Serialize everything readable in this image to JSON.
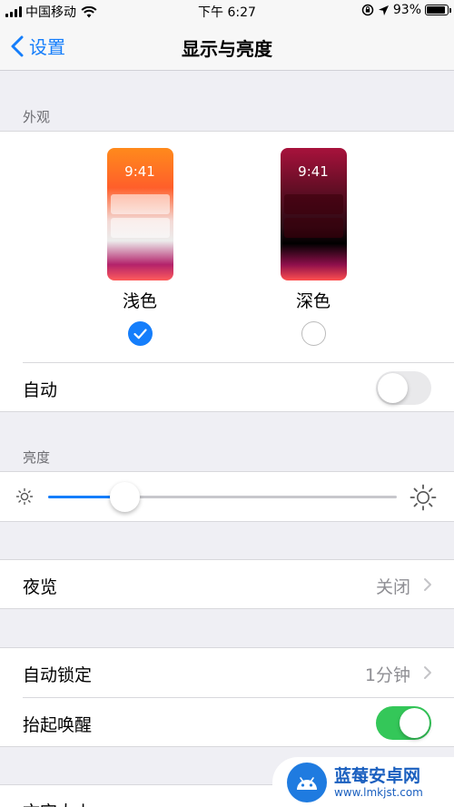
{
  "status_bar": {
    "carrier": "中国移动",
    "time": "下午 6:27",
    "battery": "93%",
    "battery_level": 0.93
  },
  "nav": {
    "back_label": "设置",
    "title": "显示与亮度"
  },
  "appearance": {
    "section_label": "外观",
    "modes": [
      {
        "label": "浅色",
        "preview_time": "9:41",
        "selected": true
      },
      {
        "label": "深色",
        "preview_time": "9:41",
        "selected": false
      }
    ],
    "auto_label": "自动",
    "auto_on": false
  },
  "brightness": {
    "section_label": "亮度",
    "level": 0.22
  },
  "night_shift": {
    "label": "夜览",
    "value": "关闭"
  },
  "auto_lock": {
    "label": "自动锁定",
    "value": "1分钟"
  },
  "raise_to_wake": {
    "label": "抬起唤醒",
    "on": true
  },
  "text_size": {
    "label": "文字大小"
  },
  "watermark": {
    "title": "蓝莓安卓网",
    "url": "www.lmkjst.com"
  },
  "colors": {
    "accent": "#157efb",
    "toggle_on": "#34c759"
  }
}
